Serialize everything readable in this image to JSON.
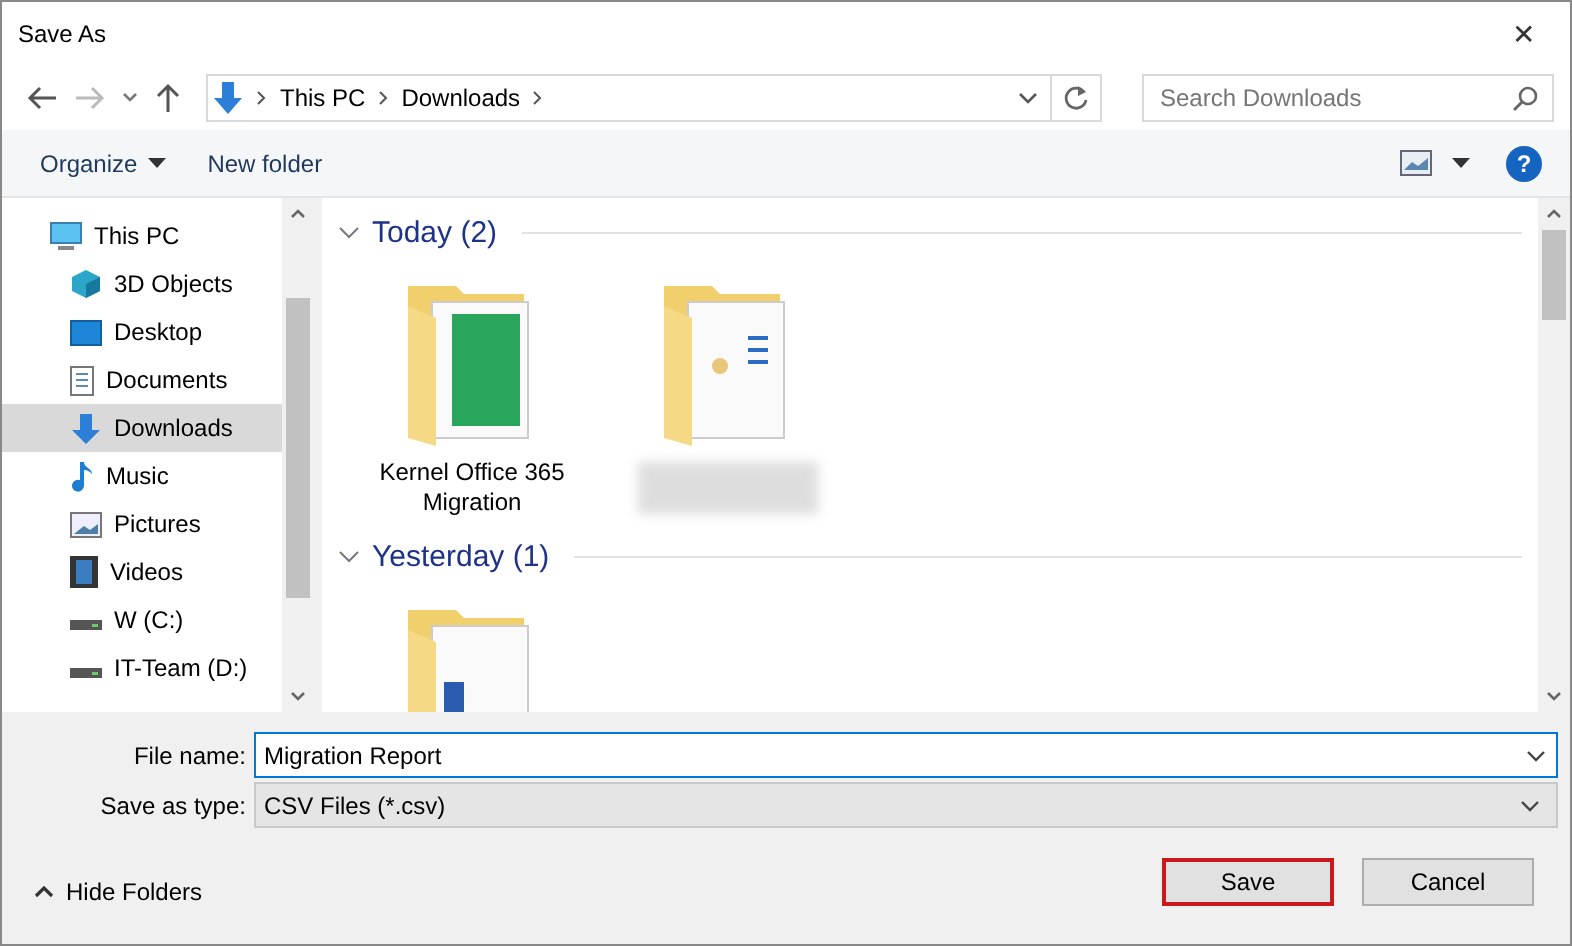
{
  "window": {
    "title": "Save As",
    "close": "✕"
  },
  "address": {
    "path": [
      "This PC",
      "Downloads"
    ],
    "search_placeholder": "Search Downloads"
  },
  "toolbar": {
    "organize": "Organize",
    "new_folder": "New folder",
    "help": "?"
  },
  "nav": [
    {
      "label": "This PC",
      "kind": "pc",
      "selected": false,
      "children": [
        {
          "label": "3D Objects",
          "kind": "cube",
          "selected": false
        },
        {
          "label": "Desktop",
          "kind": "desktop",
          "selected": false
        },
        {
          "label": "Documents",
          "kind": "doc",
          "selected": false
        },
        {
          "label": "Downloads",
          "kind": "down",
          "selected": true
        },
        {
          "label": "Music",
          "kind": "music",
          "selected": false
        },
        {
          "label": "Pictures",
          "kind": "pic",
          "selected": false
        },
        {
          "label": "Videos",
          "kind": "video",
          "selected": false
        },
        {
          "label": "W (C:)",
          "kind": "drive",
          "selected": false
        },
        {
          "label": "IT-Team (D:)",
          "kind": "drive",
          "selected": false
        }
      ]
    }
  ],
  "groups": [
    {
      "title": "Today (2)",
      "expanded": true,
      "items": [
        {
          "name": "Kernel Office 365 Migration",
          "kind": "sheet",
          "blurred": false
        },
        {
          "kind": "doc",
          "blurred": true
        }
      ]
    },
    {
      "title": "Yesterday (1)",
      "expanded": true,
      "items": [
        {
          "kind": "word",
          "blurred": false
        }
      ]
    }
  ],
  "form": {
    "file_name_label": "File name:",
    "file_name": "Migration Report",
    "type_label": "Save as type:",
    "type": "CSV Files (*.csv)"
  },
  "footer": {
    "hide_folders": "Hide Folders",
    "buttons": [
      {
        "label": "Save",
        "highlighted": true
      },
      {
        "label": "Cancel",
        "highlighted": false
      }
    ]
  }
}
